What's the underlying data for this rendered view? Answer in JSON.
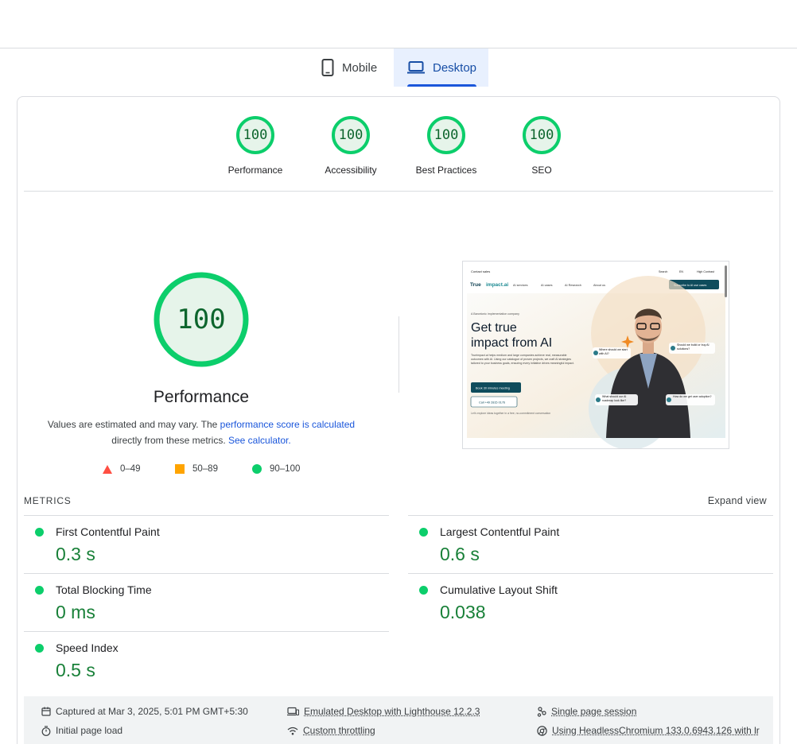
{
  "tabs": {
    "mobile": "Mobile",
    "desktop": "Desktop"
  },
  "categories": [
    {
      "score": "100",
      "label": "Performance"
    },
    {
      "score": "100",
      "label": "Accessibility"
    },
    {
      "score": "100",
      "label": "Best Practices"
    },
    {
      "score": "100",
      "label": "SEO"
    }
  ],
  "performance": {
    "score": "100",
    "score_fraction": 1.0,
    "title": "Performance",
    "note_prefix": "Values are estimated and may vary. The ",
    "note_link": "performance score is calculated",
    "note_middle": "directly from these metrics.",
    "calc_link": "See calculator."
  },
  "legend": {
    "fail": "0–49",
    "average": "50–89",
    "pass": "90–100"
  },
  "screenshot": {
    "contact": "Contact sales",
    "search": "Search",
    "lang": "EN",
    "contrast": "High Contrast",
    "logo_a": "True",
    "logo_b": "impact.ai",
    "nav": [
      "AI services",
      "AI cases",
      "AI Research",
      "About us"
    ],
    "subscribe": "Subscribe to AI use cases",
    "eyebrow": "A Barcelonic implementation company",
    "headline_1": "Get true",
    "headline_2": "impact from AI",
    "body": "Trueimpact.ai helps medium and large companies achieve real, measurable outcomes with AI. Using our catalogue of proven projects, we craft AI strategies tailored to your business goals, ensuring every initiative drives meaningful impact.",
    "cta": "Book 30 minutes meeting",
    "call": "Call +49 2815 0176",
    "sub": "Let's explore ideas together in a free, no-commitment conversation",
    "bubble_1": "Where should we start with AI?",
    "bubble_2": "Should we build or buy AI solutions?",
    "bubble_3": "What should our AI roadmap look like?",
    "bubble_4": "How do we get user adoption?"
  },
  "metrics": {
    "title": "METRICS",
    "expand": "Expand view",
    "items": [
      {
        "label": "First Contentful Paint",
        "value": "0.3 s"
      },
      {
        "label": "Largest Contentful Paint",
        "value": "0.6 s"
      },
      {
        "label": "Total Blocking Time",
        "value": "0 ms"
      },
      {
        "label": "Cumulative Layout Shift",
        "value": "0.038"
      },
      {
        "label": "Speed Index",
        "value": "0.5 s"
      }
    ]
  },
  "footer": {
    "captured": "Captured at Mar 3, 2025, 5:01 PM GMT+5:30",
    "initial": "Initial page load",
    "emulated": "Emulated Desktop with Lighthouse 12.2.3",
    "throttling": "Custom throttling",
    "session": "Single page session",
    "browser": "Using HeadlessChromium 133.0.6943.126 with lr"
  },
  "colors": {
    "pass": "#0cce6b",
    "pass_text": "#188038",
    "average": "#ffa400",
    "fail": "#ff4e42",
    "link": "#1a56db",
    "tab_active_bg": "#e8f0fe"
  }
}
